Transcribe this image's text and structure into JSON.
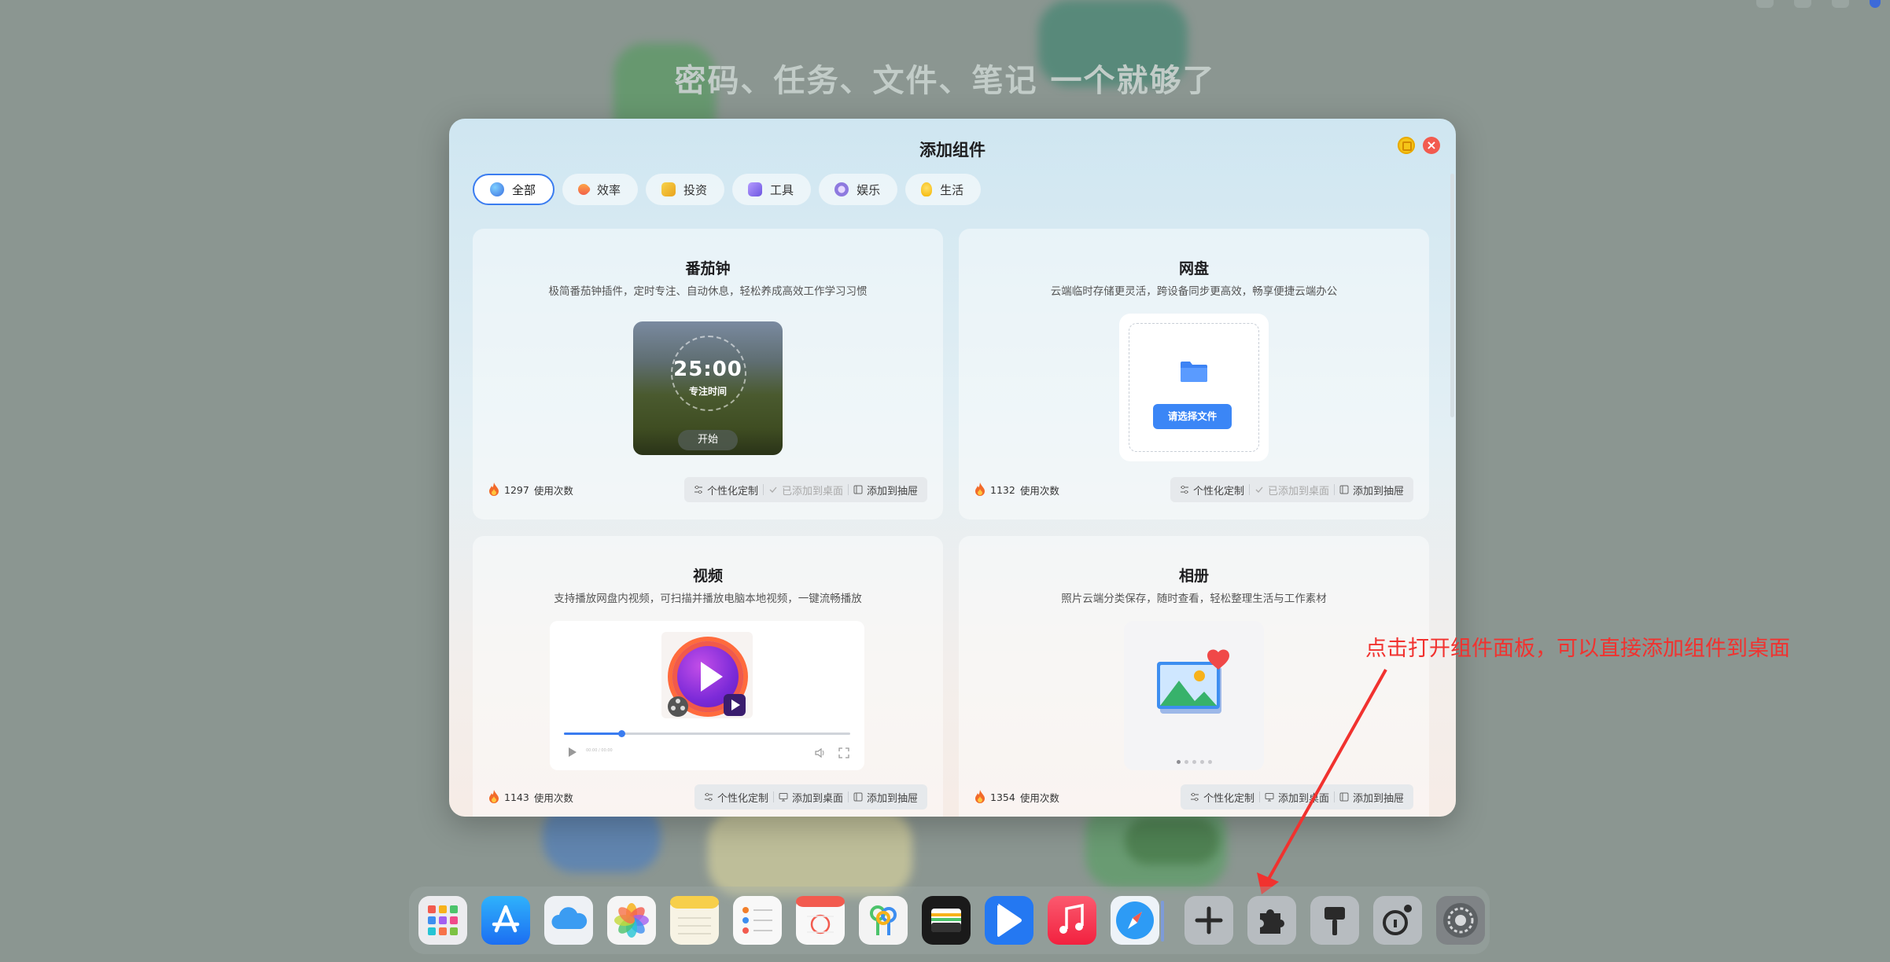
{
  "background": {
    "headline": "密码、任务、文件、笔记 一个就够了"
  },
  "modal": {
    "title": "添加组件",
    "close_glyph": "×",
    "tabs": [
      {
        "label": "全部",
        "icon": "all-icon",
        "active": true
      },
      {
        "label": "效率",
        "icon": "rocket-icon",
        "active": false
      },
      {
        "label": "投资",
        "icon": "invest-icon",
        "active": false
      },
      {
        "label": "工具",
        "icon": "toolbox-icon",
        "active": false
      },
      {
        "label": "娱乐",
        "icon": "headphones-icon",
        "active": false
      },
      {
        "label": "生活",
        "icon": "lightbulb-icon",
        "active": false
      }
    ],
    "cards": [
      {
        "title": "番茄钟",
        "desc": "极简番茄钟插件，定时专注、自动休息，轻松养成高效工作学习习惯",
        "usage_count": "1297",
        "usage_label": "使用次数",
        "preview": {
          "time": "25:00",
          "subtitle": "专注时间",
          "button": "开始"
        },
        "actions": {
          "customize": "个性化定制",
          "desktop": "已添加到桌面",
          "desktop_disabled": true,
          "drawer": "添加到抽屉"
        }
      },
      {
        "title": "网盘",
        "desc": "云端临时存储更灵活，跨设备同步更高效，畅享便捷云端办公",
        "usage_count": "1132",
        "usage_label": "使用次数",
        "preview": {
          "button": "请选择文件"
        },
        "actions": {
          "customize": "个性化定制",
          "desktop": "已添加到桌面",
          "desktop_disabled": true,
          "drawer": "添加到抽屉"
        }
      },
      {
        "title": "视频",
        "desc": "支持播放网盘内视频，可扫描并播放电脑本地视频，一键流畅播放",
        "usage_count": "1143",
        "usage_label": "使用次数",
        "preview": {
          "progress": 0.2,
          "time_text": "00:00 / 00:00"
        },
        "actions": {
          "customize": "个性化定制",
          "desktop": "添加到桌面",
          "desktop_disabled": false,
          "drawer": "添加到抽屉"
        }
      },
      {
        "title": "相册",
        "desc": "照片云端分类保存，随时查看，轻松整理生活与工作素材",
        "usage_count": "1354",
        "usage_label": "使用次数",
        "preview": {
          "dots": 5,
          "active_dot": 0
        },
        "actions": {
          "customize": "个性化定制",
          "desktop": "添加到桌面",
          "desktop_disabled": false,
          "drawer": "添加到抽屉"
        }
      }
    ]
  },
  "annotation": {
    "text": "点击打开组件面板，可以直接添加组件到桌面",
    "color": "#f1322f"
  },
  "dock": {
    "items": [
      {
        "name": "launchpad-icon",
        "color": "#e9e9ec"
      },
      {
        "name": "app-store-icon",
        "color": "#1c8cf5"
      },
      {
        "name": "icloud-icon",
        "color": "#eef1f5"
      },
      {
        "name": "photos-icon",
        "color": "#f4f4f4"
      },
      {
        "name": "notes-icon",
        "color": "#f7f3e4"
      },
      {
        "name": "reminders-icon",
        "color": "#f6f6f6"
      },
      {
        "name": "calendar-icon",
        "color": "#f8f8f8"
      },
      {
        "name": "passwords-icon",
        "color": "#f3f3f3"
      },
      {
        "name": "wallet-icon",
        "color": "#1a1a1a"
      },
      {
        "name": "video-player-icon",
        "color": "#2478f2"
      },
      {
        "name": "music-icon",
        "color": "#f5334f"
      },
      {
        "name": "safari-icon",
        "color": "#eef3f8"
      },
      {
        "name": "add-icon",
        "color": "#b7bcc0"
      },
      {
        "name": "widgets-puzzle-icon",
        "color": "#b7bcc0"
      },
      {
        "name": "brush-icon",
        "color": "#b7bcc0"
      },
      {
        "name": "key-settings-icon",
        "color": "#b7bcc0"
      },
      {
        "name": "settings-icon",
        "color": "#7f8386"
      }
    ]
  }
}
